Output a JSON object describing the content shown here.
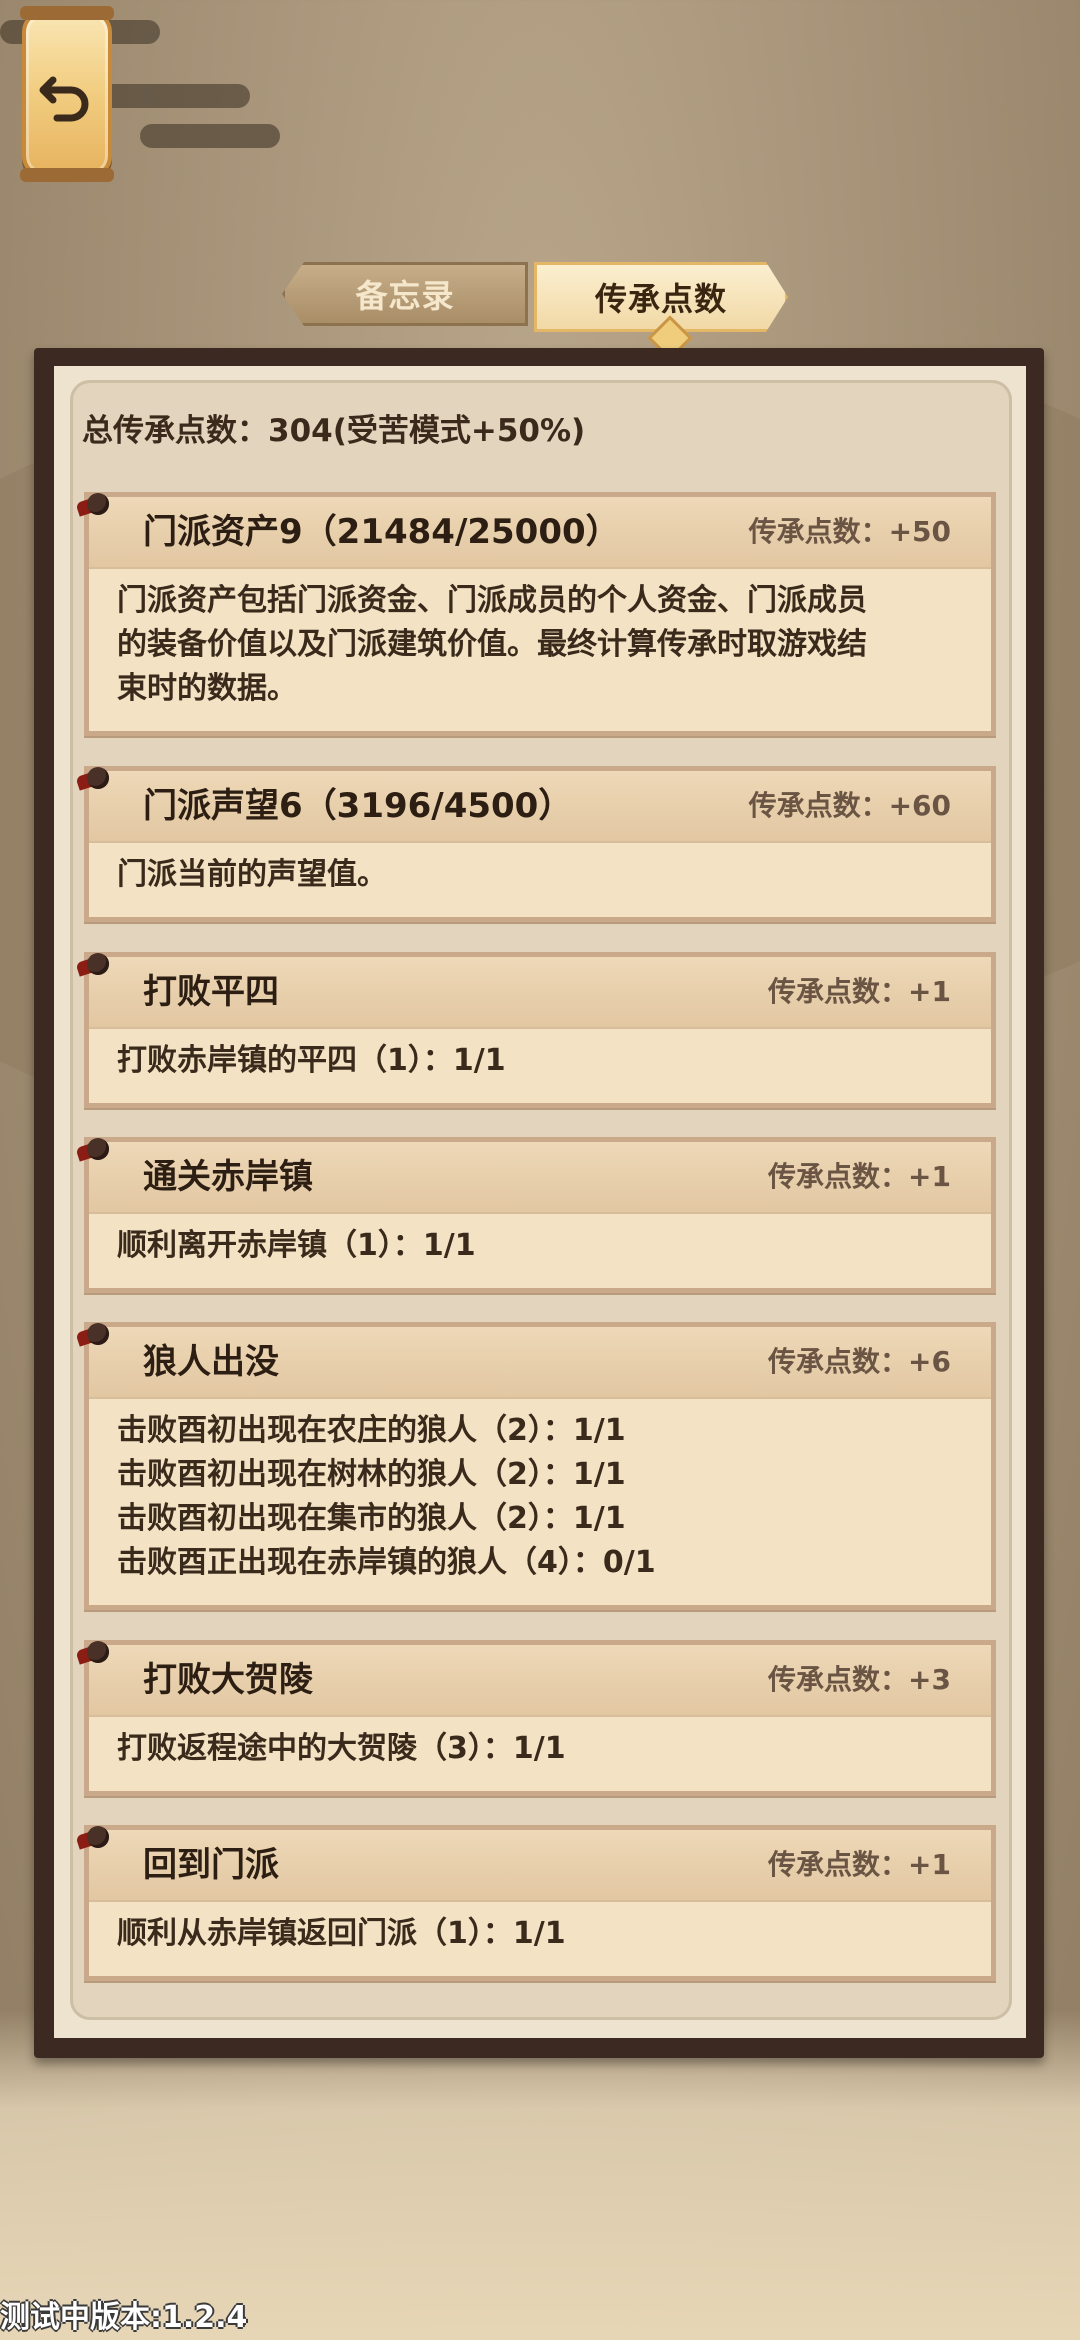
{
  "tabs": {
    "memo": "备忘录",
    "inheritance": "传承点数"
  },
  "summary": {
    "total": "总传承点数：304(受苦模式+50%)"
  },
  "cards": [
    {
      "title": "门派资产9（21484/25000）",
      "points": "传承点数：+50",
      "lines": [
        "门派资产包括门派资金、门派成员的个人资金、门派成员",
        "的装备价值以及门派建筑价值。最终计算传承时取游戏结",
        "束时的数据。"
      ]
    },
    {
      "title": "门派声望6（3196/4500）",
      "points": "传承点数：+60",
      "lines": [
        "门派当前的声望值。"
      ]
    },
    {
      "title": "打败平四",
      "points": "传承点数：+1",
      "lines": [
        "打败赤岸镇的平四（1）：1/1"
      ]
    },
    {
      "title": "通关赤岸镇",
      "points": "传承点数：+1",
      "lines": [
        "顺利离开赤岸镇（1）：1/1"
      ]
    },
    {
      "title": "狼人出没",
      "points": "传承点数：+6",
      "lines": [
        "击败酉初出现在农庄的狼人（2）：1/1",
        "击败酉初出现在树林的狼人（2）：1/1",
        "击败酉初出现在集市的狼人（2）：1/1",
        "击败酉正出现在赤岸镇的狼人（4）：0/1"
      ]
    },
    {
      "title": "打败大贺陵",
      "points": "传承点数：+3",
      "lines": [
        "打败返程途中的大贺陵（3）：1/1"
      ]
    },
    {
      "title": "回到门派",
      "points": "传承点数：+1",
      "lines": [
        "顺利从赤岸镇返回门派（1）：1/1"
      ]
    }
  ],
  "footer": {
    "version": "测试中版本:1.2.4"
  },
  "colors": {
    "panel_border": "#3c2a22",
    "card_bg": "#f3e3c4",
    "accent_gold": "#f0cd7d"
  },
  "icons": {
    "back": "back-arrow-icon",
    "pin": "scroll-pin-icon"
  }
}
